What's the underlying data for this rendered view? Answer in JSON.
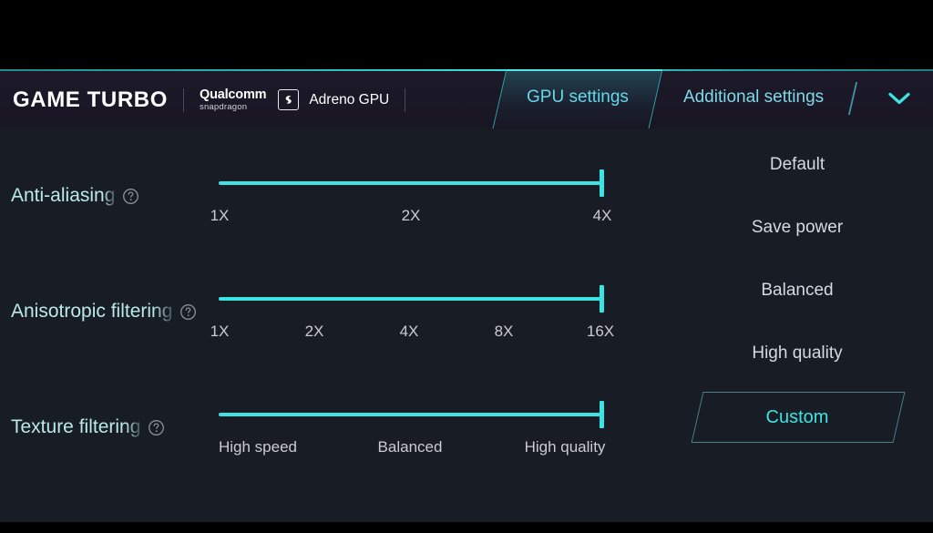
{
  "header": {
    "brand_title": "GAME TURBO",
    "chipset": {
      "qualcomm_main": "Qualcomm",
      "qualcomm_sub": "snapdragon",
      "badge_icon": "snapdragon-s-icon",
      "gpu_label": "Adreno GPU"
    },
    "tabs": [
      {
        "label": "GPU settings",
        "active": true
      },
      {
        "label": "Additional settings",
        "active": false
      }
    ],
    "expand_icon": "chevron-down-icon",
    "accent_color": "#3ce3e3"
  },
  "settings": {
    "rows": [
      {
        "label": "Anti-aliasing",
        "help_icon": "help-circle-icon",
        "ticks": [
          "1X",
          "2X",
          "4X"
        ],
        "value": "4X",
        "value_index": 2
      },
      {
        "label": "Anisotropic filtering",
        "help_icon": "help-circle-icon",
        "ticks": [
          "1X",
          "2X",
          "4X",
          "8X",
          "16X"
        ],
        "value": "16X",
        "value_index": 4
      },
      {
        "label": "Texture filtering",
        "help_icon": "help-circle-icon",
        "ticks": [
          "High speed",
          "Balanced",
          "High quality"
        ],
        "value": "High quality",
        "value_index": 2
      }
    ]
  },
  "presets": {
    "items": [
      {
        "label": "Default",
        "selected": false
      },
      {
        "label": "Save power",
        "selected": false
      },
      {
        "label": "Balanced",
        "selected": false
      },
      {
        "label": "High quality",
        "selected": false
      },
      {
        "label": "Custom",
        "selected": true
      }
    ]
  }
}
